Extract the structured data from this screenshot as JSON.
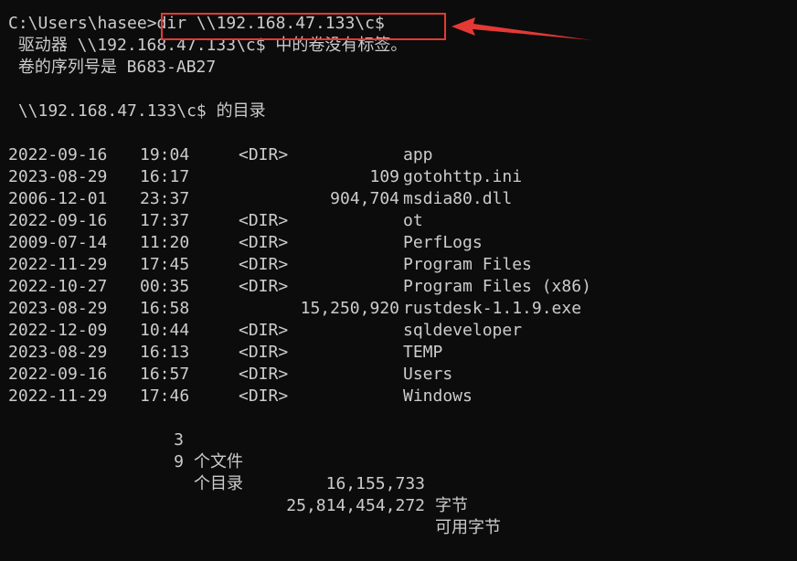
{
  "prompt": {
    "path": "C:\\Users\\hasee",
    "command": ">dir \\\\192.168.47.133\\c$"
  },
  "volume_line": " 驱动器 \\\\192.168.47.133\\c$ 中的卷没有标签。",
  "serial_line": " 卷的序列号是 B683-AB27",
  "directory_line": " \\\\192.168.47.133\\c$ 的目录",
  "entries": [
    {
      "date": "2022-09-16",
      "time": "19:04",
      "dir": "<DIR>",
      "size": "",
      "name": "app"
    },
    {
      "date": "2023-08-29",
      "time": "16:17",
      "dir": "",
      "size": "109",
      "name": "gotohttp.ini"
    },
    {
      "date": "2006-12-01",
      "time": "23:37",
      "dir": "",
      "size": "904,704",
      "name": "msdia80.dll"
    },
    {
      "date": "2022-09-16",
      "time": "17:37",
      "dir": "<DIR>",
      "size": "",
      "name": "ot"
    },
    {
      "date": "2009-07-14",
      "time": "11:20",
      "dir": "<DIR>",
      "size": "",
      "name": "PerfLogs"
    },
    {
      "date": "2022-11-29",
      "time": "17:45",
      "dir": "<DIR>",
      "size": "",
      "name": "Program Files"
    },
    {
      "date": "2022-10-27",
      "time": "00:35",
      "dir": "<DIR>",
      "size": "",
      "name": "Program Files (x86)"
    },
    {
      "date": "2023-08-29",
      "time": "16:58",
      "dir": "",
      "size": "15,250,920",
      "name": "rustdesk-1.1.9.exe"
    },
    {
      "date": "2022-12-09",
      "time": "10:44",
      "dir": "<DIR>",
      "size": "",
      "name": "sqldeveloper"
    },
    {
      "date": "2023-08-29",
      "time": "16:13",
      "dir": "<DIR>",
      "size": "",
      "name": "TEMP"
    },
    {
      "date": "2022-09-16",
      "time": "16:57",
      "dir": "<DIR>",
      "size": "",
      "name": "Users"
    },
    {
      "date": "2022-11-29",
      "time": "17:46",
      "dir": "<DIR>",
      "size": "",
      "name": "Windows"
    }
  ],
  "summary": {
    "files_count": "3",
    "files_label": "个文件",
    "files_bytes": "16,155,733",
    "files_unit": "字节",
    "dirs_count": "9",
    "dirs_label": "个目录",
    "dirs_bytes": "25,814,454,272",
    "dirs_unit": "可用字节"
  },
  "annotation": {
    "box_color": "#e53935",
    "arrow_color": "#e53935"
  }
}
